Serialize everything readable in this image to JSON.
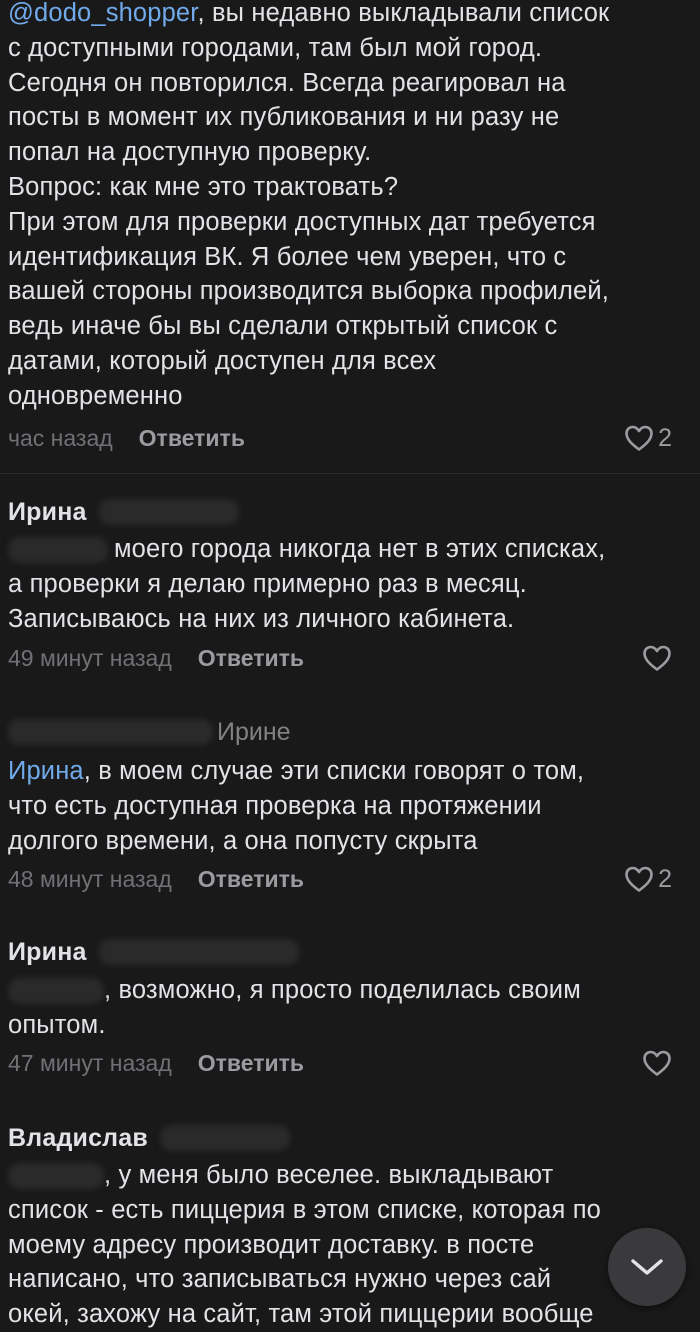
{
  "comments": [
    {
      "mention": "@dodo_shopper",
      "text_rest": ", вы недавно выкладывали список\nс доступными городами, там был мой город.\nСегодня он повторился. Всегда реагировал на\nпосты в момент их публикования и ни разу не\nпопал на доступную проверку.\nВопрос: как мне это трактовать?\nПри этом для проверки доступных дат требуется\nидентификация ВК. Я более чем уверен, что с\nвашей стороны производится выборка профилей,\nведь иначе бы вы сделали открытый список с\nдатами, который доступен для всех\nодновременно",
      "time": "час назад",
      "reply_label": "Ответить",
      "likes": "2"
    },
    {
      "author": "Ирина",
      "text": "моего города никогда нет в этих списках,\nа проверки я делаю примерно раз в месяц.\nЗаписываюсь на них из личного кабинета.",
      "time": "49 минут назад",
      "reply_label": "Ответить",
      "likes": ""
    },
    {
      "reply_to": "Ирине",
      "mention": "Ирина",
      "text_rest": ", в моем случае эти списки говорят о том,\nчто есть доступная проверка на протяжении\nдолгого времени, а она попусту скрыта",
      "time": "48 минут назад",
      "reply_label": "Ответить",
      "likes": "2"
    },
    {
      "author": "Ирина",
      "text_first": ", возможно, я просто поделилась своим",
      "text_rest": "опытом.",
      "time": "47 минут назад",
      "reply_label": "Ответить",
      "likes": ""
    },
    {
      "author": "Владислав",
      "text_first": ", у меня было веселее. выкладывают",
      "text_rest": "список - есть пиццерия в этом списке, которая по\nмоему адресу производит доставку. в посте\nнаписано, что записываться нужно через сай\nокей, захожу на сайт, там этой пиццерии вообще"
    }
  ],
  "icons": {
    "like": "heart-outline-icon",
    "scroll": "chevron-down-icon"
  },
  "colors": {
    "background": "#19191a",
    "text": "#e1e3e6",
    "link": "#71aaeb",
    "secondary": "#6f7175"
  }
}
